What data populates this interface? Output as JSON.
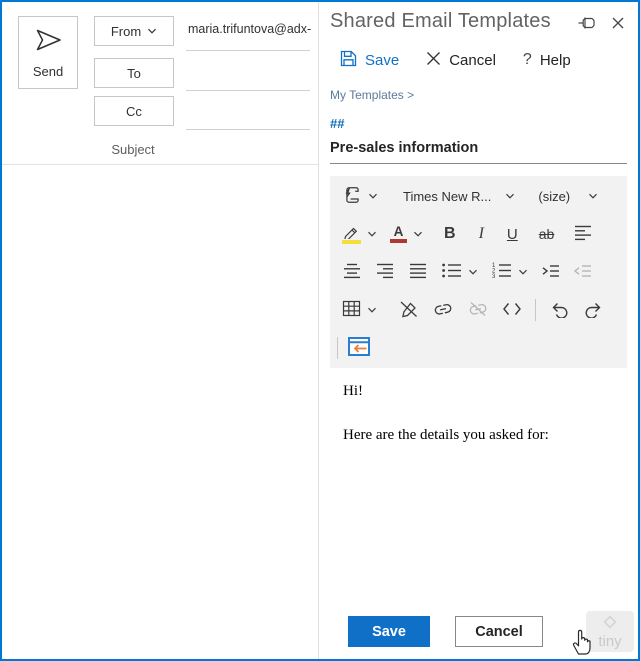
{
  "compose": {
    "send_label": "Send",
    "from_label": "From",
    "from_value": "maria.trifuntova@adx-",
    "to_label": "To",
    "cc_label": "Cc",
    "subject_label": "Subject"
  },
  "addin": {
    "title": "Shared Email Templates",
    "actions": {
      "save": "Save",
      "cancel": "Cancel",
      "help": "Help",
      "help_mark": "?"
    },
    "breadcrumb": "My Templates >",
    "shortcut": "##",
    "template_name": "Pre-sales information",
    "editor": {
      "font_name_display": "Times New R...",
      "font_size_display": "(size)",
      "bold": "B",
      "italic": "I",
      "underline": "U",
      "strikethrough": "ab",
      "body_line1": "Hi!",
      "body_line2": "Here are the details you asked for:"
    },
    "footer": {
      "save": "Save",
      "cancel": "Cancel"
    },
    "watermark": "tiny"
  },
  "colors": {
    "window_border": "#0078d4",
    "accent_blue": "#1070c8",
    "link_blue": "#0f6cbd",
    "breadcrumb_blue": "#5d7b9a",
    "toolbar_bg": "#f2f2f2",
    "highlight_yellow": "#f3df3b",
    "font_color_red": "#ad3a32",
    "insert_icon_blue": "#2b7cd3",
    "insert_icon_orange": "#e8813c"
  }
}
